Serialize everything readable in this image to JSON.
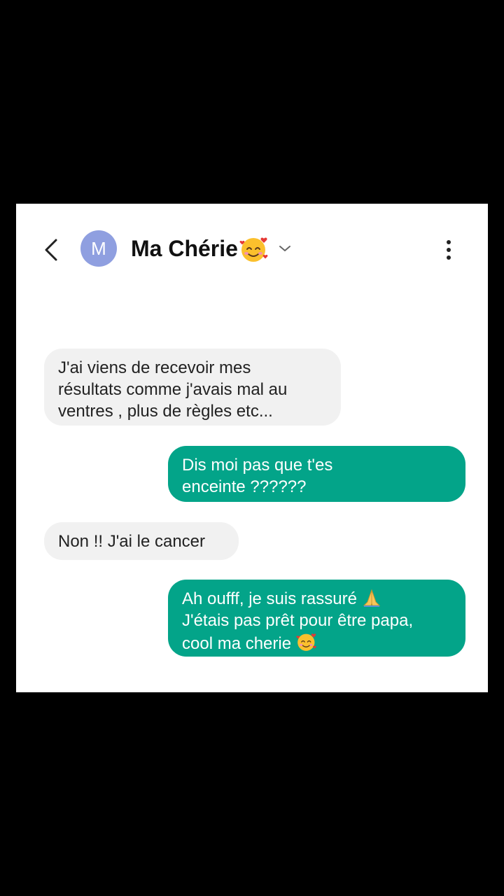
{
  "header": {
    "avatar_letter": "M",
    "contact_name": "Ma Chérie",
    "contact_name_emoji": "smiling-face-with-hearts-emoji"
  },
  "icons": {
    "back": "back-arrow-icon",
    "dropdown": "chevron-down-icon",
    "menu": "more-vertical-icon",
    "pray": "folded-hands-emoji",
    "love": "smiling-face-with-hearts-emoji"
  },
  "colors": {
    "outgoing_bubble": "#03a489",
    "incoming_bubble": "#f1f1f1",
    "avatar": "#8f9fe0"
  },
  "messages": [
    {
      "direction": "incoming",
      "lines": [
        "J'ai viens de recevoir mes",
        "résultats comme j'avais mal au",
        "ventres , plus de règles etc..."
      ]
    },
    {
      "direction": "outgoing",
      "lines": [
        "Dis moi pas que t'es",
        "enceinte ??????"
      ]
    },
    {
      "direction": "incoming",
      "lines": [
        "Non !! J'ai le cancer"
      ]
    },
    {
      "direction": "outgoing",
      "lines": [
        "Ah oufff, je suis rassuré",
        "J'étais pas prêt pour être papa,",
        "cool ma cherie"
      ]
    }
  ]
}
